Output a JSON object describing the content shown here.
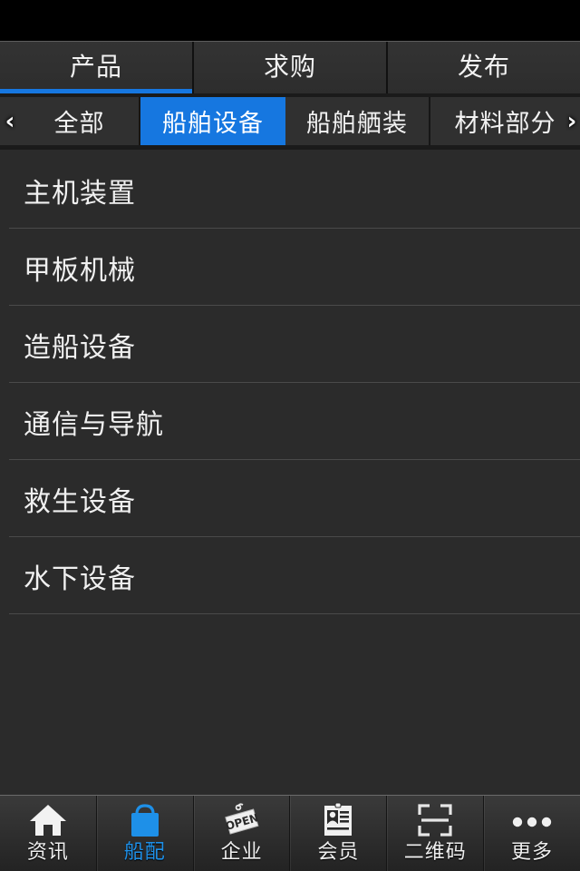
{
  "theme": {
    "accent": "#1677e0",
    "accent_nav": "#1e90e8",
    "background": "#2b2b2b",
    "statusbar": "#000000",
    "text": "#f0f0f0"
  },
  "statusbar": {
    "label": ""
  },
  "top_tabs": {
    "items": [
      {
        "label": "产品",
        "active": true
      },
      {
        "label": "求购",
        "active": false
      },
      {
        "label": "发布",
        "active": false
      }
    ]
  },
  "category_strip": {
    "prev_arrow": "‹",
    "next_arrow": "›",
    "items": [
      {
        "label": "全部",
        "active": false
      },
      {
        "label": "船舶设备",
        "active": true
      },
      {
        "label": "船舶舾装",
        "active": false
      },
      {
        "label": "材料部分",
        "active": false
      }
    ]
  },
  "list": {
    "items": [
      {
        "label": "主机装置"
      },
      {
        "label": "甲板机械"
      },
      {
        "label": "造船设备"
      },
      {
        "label": "通信与导航"
      },
      {
        "label": "救生设备"
      },
      {
        "label": "水下设备"
      }
    ]
  },
  "bottom_nav": {
    "items": [
      {
        "label": "资讯",
        "icon": "home-icon",
        "active": false
      },
      {
        "label": "船配",
        "icon": "shopping-bag-icon",
        "active": true
      },
      {
        "label": "企业",
        "icon": "open-sign-icon",
        "active": false
      },
      {
        "label": "会员",
        "icon": "id-card-icon",
        "active": false
      },
      {
        "label": "二维码",
        "icon": "qr-scan-icon",
        "active": false
      },
      {
        "label": "更多",
        "icon": "more-dots-icon",
        "active": false
      }
    ]
  }
}
